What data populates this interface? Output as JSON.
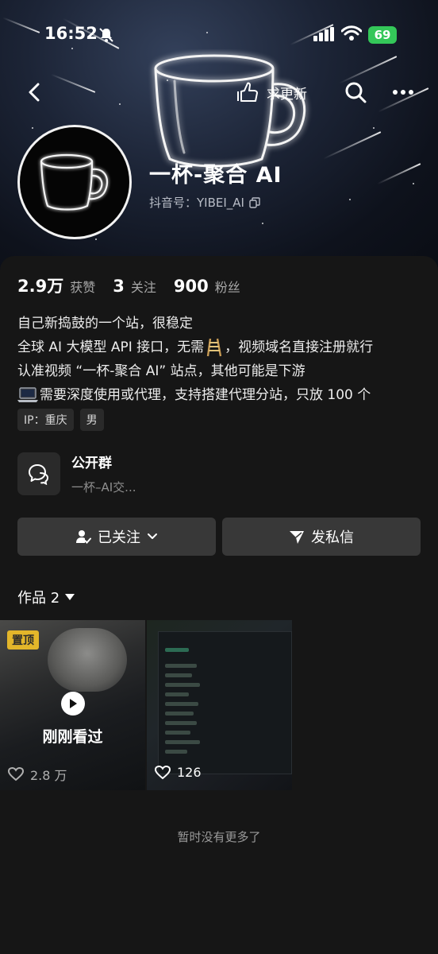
{
  "status_bar": {
    "time": "16:52",
    "battery": "69"
  },
  "nav": {
    "update_label": "求更新"
  },
  "profile": {
    "name": "一杯-聚合 AI",
    "id_label": "抖音号：YIBEI_AI"
  },
  "stats": {
    "likes_value": "2.9万",
    "likes_label": "获赞",
    "following_value": "3",
    "following_label": "关注",
    "followers_value": "900",
    "followers_label": "粉丝"
  },
  "bio": {
    "line1": "自己新捣鼓的一个站，很稳定",
    "line2a": "全球 AI 大模型 API 接口，无需",
    "line2b": "，视频域名直接注册就行",
    "line3": "认准视频 “一杯-聚合 AI” 站点，其他可能是下游",
    "line4": "需要深度使用或代理，支持搭建代理分站，只放 100 个"
  },
  "tags": {
    "ip": "IP：重庆",
    "gender": "男"
  },
  "group": {
    "title": "公开群",
    "subtitle": "一杯–AI交..."
  },
  "buttons": {
    "follow": "已关注",
    "message": "发私信"
  },
  "works": {
    "label": "作品 2"
  },
  "videos": [
    {
      "pin": "置顶",
      "watched": "刚刚看过",
      "likes": "2.8 万"
    },
    {
      "likes": "126"
    }
  ],
  "footer": {
    "no_more": "暂时没有更多了"
  }
}
